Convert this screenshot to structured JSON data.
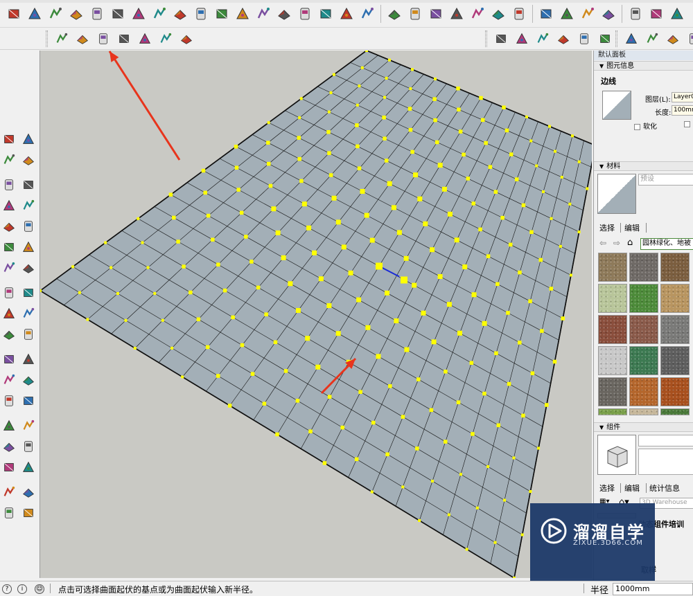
{
  "panel": {
    "title": "默认面板",
    "entity_info": {
      "header": "图元信息",
      "type": "边线",
      "layer_label": "图层(L):",
      "layer_value": "Layer0",
      "length_label": "长度:",
      "length_value": "100mm",
      "soften_label": "软化"
    },
    "materials": {
      "header": "材料",
      "name_placeholder": "预设",
      "tab_select": "选择",
      "tab_edit": "编辑",
      "library": "园林绿化、地被"
    },
    "components": {
      "header": "组件",
      "tab_select": "选择",
      "tab_edit": "编辑",
      "tab_stats": "统计信息",
      "search_placeholder": "3D Warehouse",
      "item_title": "动态组件培训",
      "item_sub": "取样"
    }
  },
  "status": {
    "hint": "点击可选择曲面起伏的基点或为曲面起伏输入新半径。",
    "measure_label": "半径",
    "measure_value": "1000mm"
  },
  "watermark": {
    "brand": "溜溜自学",
    "url": "ZIXUE.3D66.COM"
  },
  "colors": {
    "face": "#a3afb7",
    "vertex": "#ffff00",
    "arrow": "#e8341c",
    "background": "#c9c9c4",
    "axis_blue": "#1a2bd6"
  },
  "icons": {
    "toolbar1": [
      "select-icon",
      "component-icon",
      "paint-icon",
      "eraser-icon",
      "rectangle-icon",
      "line-icon",
      "arc-icon",
      "freehand-icon",
      "pushpull-icon",
      "offset-icon",
      "move-icon",
      "rotate-icon",
      "scale-icon",
      "followme-icon",
      "tape-icon",
      "protractor-icon",
      "text-icon",
      "axes-icon",
      "dimension-icon",
      "orbit-icon",
      "pan-icon",
      "zoom-icon",
      "zoomwindow-icon",
      "zoomextents-icon",
      "walk-icon",
      "lookaround-icon",
      "section-icon",
      "warehouse-icon",
      "extension-icon",
      "layout-icon",
      "ruby-icon",
      "su-app-icon"
    ],
    "toolbar2_sandbox": [
      "sandbox-contours-icon",
      "sandbox-grid-icon",
      "smoove-icon",
      "stamp-icon",
      "drape-icon",
      "add-detail-icon",
      "flip-edge-icon"
    ],
    "toolbar2_views": [
      "iso-view-icon",
      "top-view-icon",
      "front-view-icon",
      "right-view-icon",
      "back-view-icon",
      "left-view-icon"
    ],
    "toolbar2_styles": [
      "xray-icon",
      "wireframe-icon",
      "hidden-line-icon",
      "shaded-icon"
    ]
  }
}
